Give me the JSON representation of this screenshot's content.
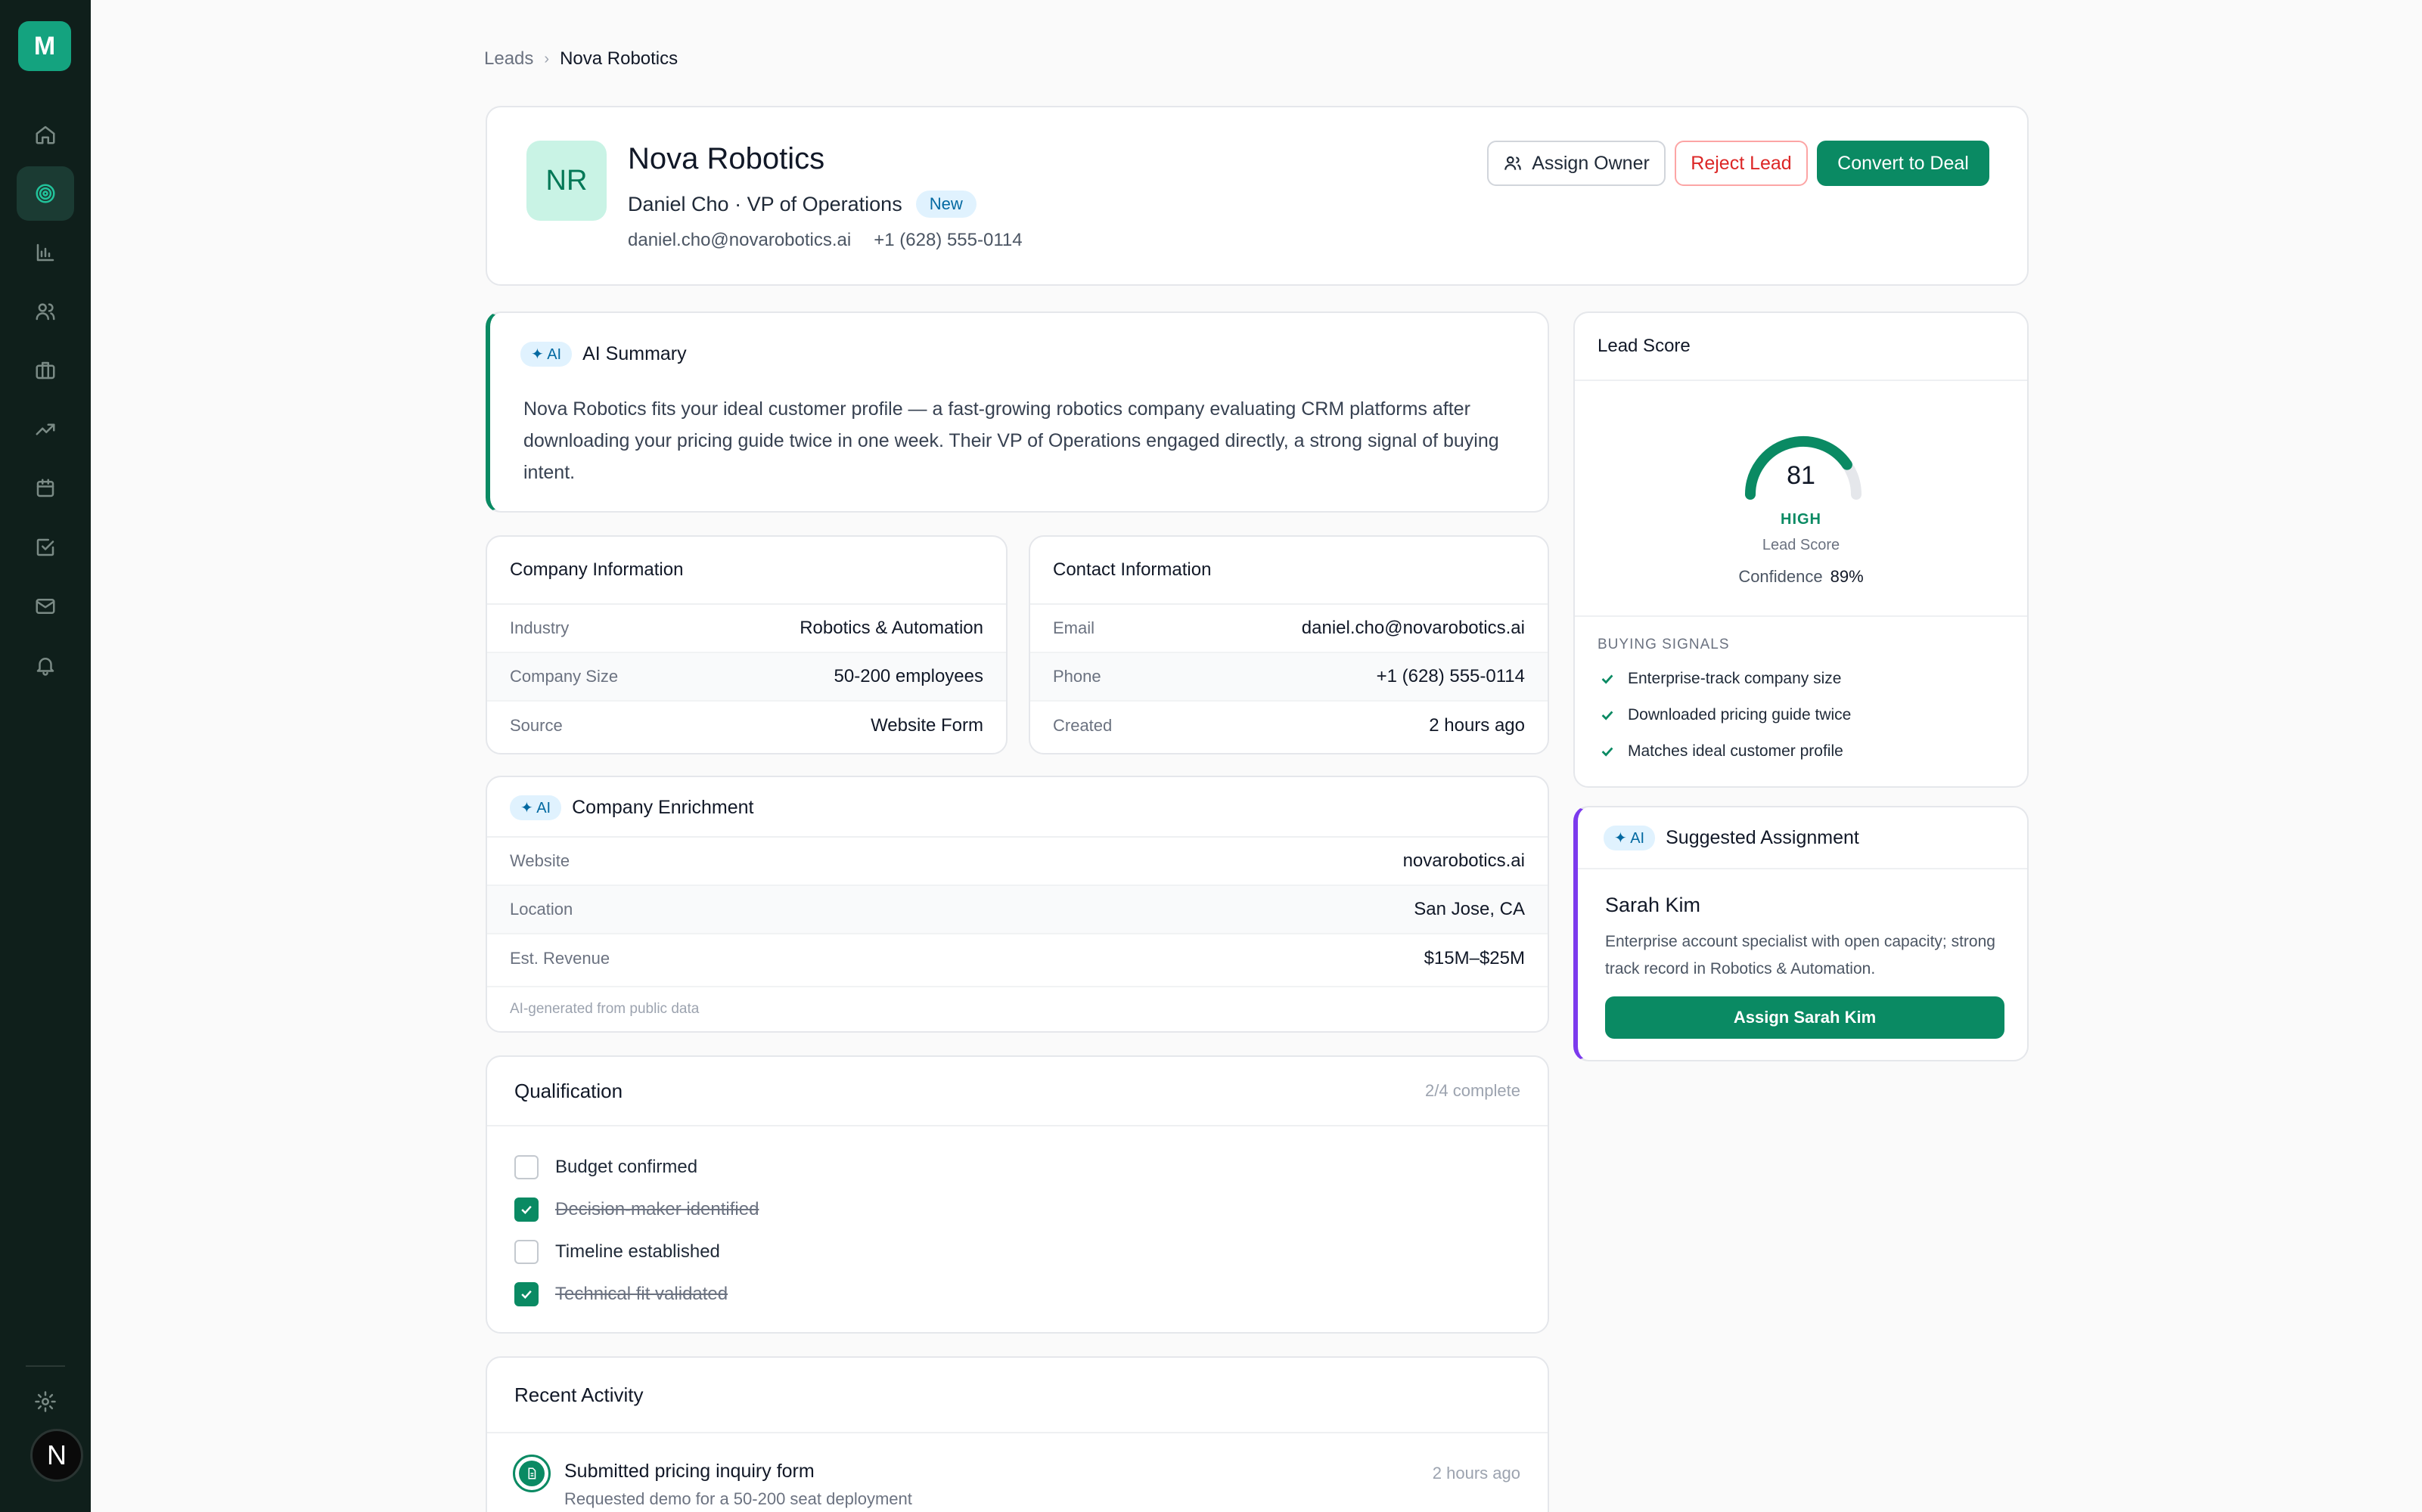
{
  "app": {
    "logo_letter": "M",
    "user_initial": "N"
  },
  "sidebar": {
    "items": [
      {
        "name": "home-icon",
        "active": false
      },
      {
        "name": "target-icon",
        "active": true
      },
      {
        "name": "bar-chart-icon",
        "active": false
      },
      {
        "name": "users-icon",
        "active": false
      },
      {
        "name": "briefcase-icon",
        "active": false
      },
      {
        "name": "trending-up-icon",
        "active": false
      },
      {
        "name": "calendar-icon",
        "active": false
      },
      {
        "name": "check-square-icon",
        "active": false
      },
      {
        "name": "mail-icon",
        "active": false
      },
      {
        "name": "bell-icon",
        "active": false
      }
    ],
    "settings_icon": "gear-icon"
  },
  "breadcrumb": {
    "parent": "Leads",
    "separator": "›",
    "current": "Nova Robotics"
  },
  "lead": {
    "initials": "NR",
    "company": "Nova Robotics",
    "contact_line": "Daniel Cho · VP of Operations",
    "status": "New",
    "email": "daniel.cho@novarobotics.ai",
    "phone": "+1 (628) 555-0114"
  },
  "actions": {
    "assign_owner": "Assign Owner",
    "reject": "Reject Lead",
    "convert": "Convert to Deal"
  },
  "ai_summary": {
    "badge": "✦ AI",
    "title": "AI Summary",
    "text": "Nova Robotics fits your ideal customer profile — a fast-growing robotics company evaluating CRM platforms after downloading your pricing guide twice in one week. Their VP of Operations engaged directly, a strong signal of buying intent."
  },
  "company_info": {
    "title": "Company Information",
    "rows": [
      {
        "label": "Industry",
        "value": "Robotics & Automation"
      },
      {
        "label": "Company Size",
        "value": "50-200 employees"
      },
      {
        "label": "Source",
        "value": "Website Form"
      }
    ]
  },
  "contact_info": {
    "title": "Contact Information",
    "rows": [
      {
        "label": "Email",
        "value": "daniel.cho@novarobotics.ai"
      },
      {
        "label": "Phone",
        "value": "+1 (628) 555-0114"
      },
      {
        "label": "Created",
        "value": "2 hours ago"
      }
    ]
  },
  "enrichment": {
    "badge": "✦ AI",
    "title": "Company Enrichment",
    "rows": [
      {
        "label": "Website",
        "value": "novarobotics.ai"
      },
      {
        "label": "Location",
        "value": "San Jose, CA"
      },
      {
        "label": "Est. Revenue",
        "value": "$15M–$25M"
      }
    ],
    "footnote": "AI-generated from public data"
  },
  "qualification": {
    "title": "Qualification",
    "progress": "2/4 complete",
    "items": [
      {
        "label": "Budget confirmed",
        "checked": false
      },
      {
        "label": "Decision-maker identified",
        "checked": true
      },
      {
        "label": "Timeline established",
        "checked": false
      },
      {
        "label": "Technical fit validated",
        "checked": true
      }
    ]
  },
  "activity": {
    "title": "Recent Activity",
    "items": [
      {
        "title": "Submitted pricing inquiry form",
        "desc": "Requested demo for a 50-200 seat deployment",
        "time": "2 hours ago"
      }
    ]
  },
  "lead_score": {
    "title": "Lead Score",
    "score": 81,
    "max": 100,
    "level": "HIGH",
    "label": "Lead Score",
    "confidence_label": "Confidence",
    "confidence_value": "89%",
    "signals_title": "BUYING SIGNALS",
    "signals": [
      "Enterprise-track company size",
      "Downloaded pricing guide twice",
      "Matches ideal customer profile"
    ],
    "colors": {
      "arc": "#0a8a63",
      "track": "#e5e7eb"
    }
  },
  "suggested_assignment": {
    "badge": "✦ AI",
    "title": "Suggested Assignment",
    "name": "Sarah Kim",
    "desc": "Enterprise account specialist with open capacity; strong track record in Robotics & Automation.",
    "button": "Assign Sarah Kim"
  }
}
